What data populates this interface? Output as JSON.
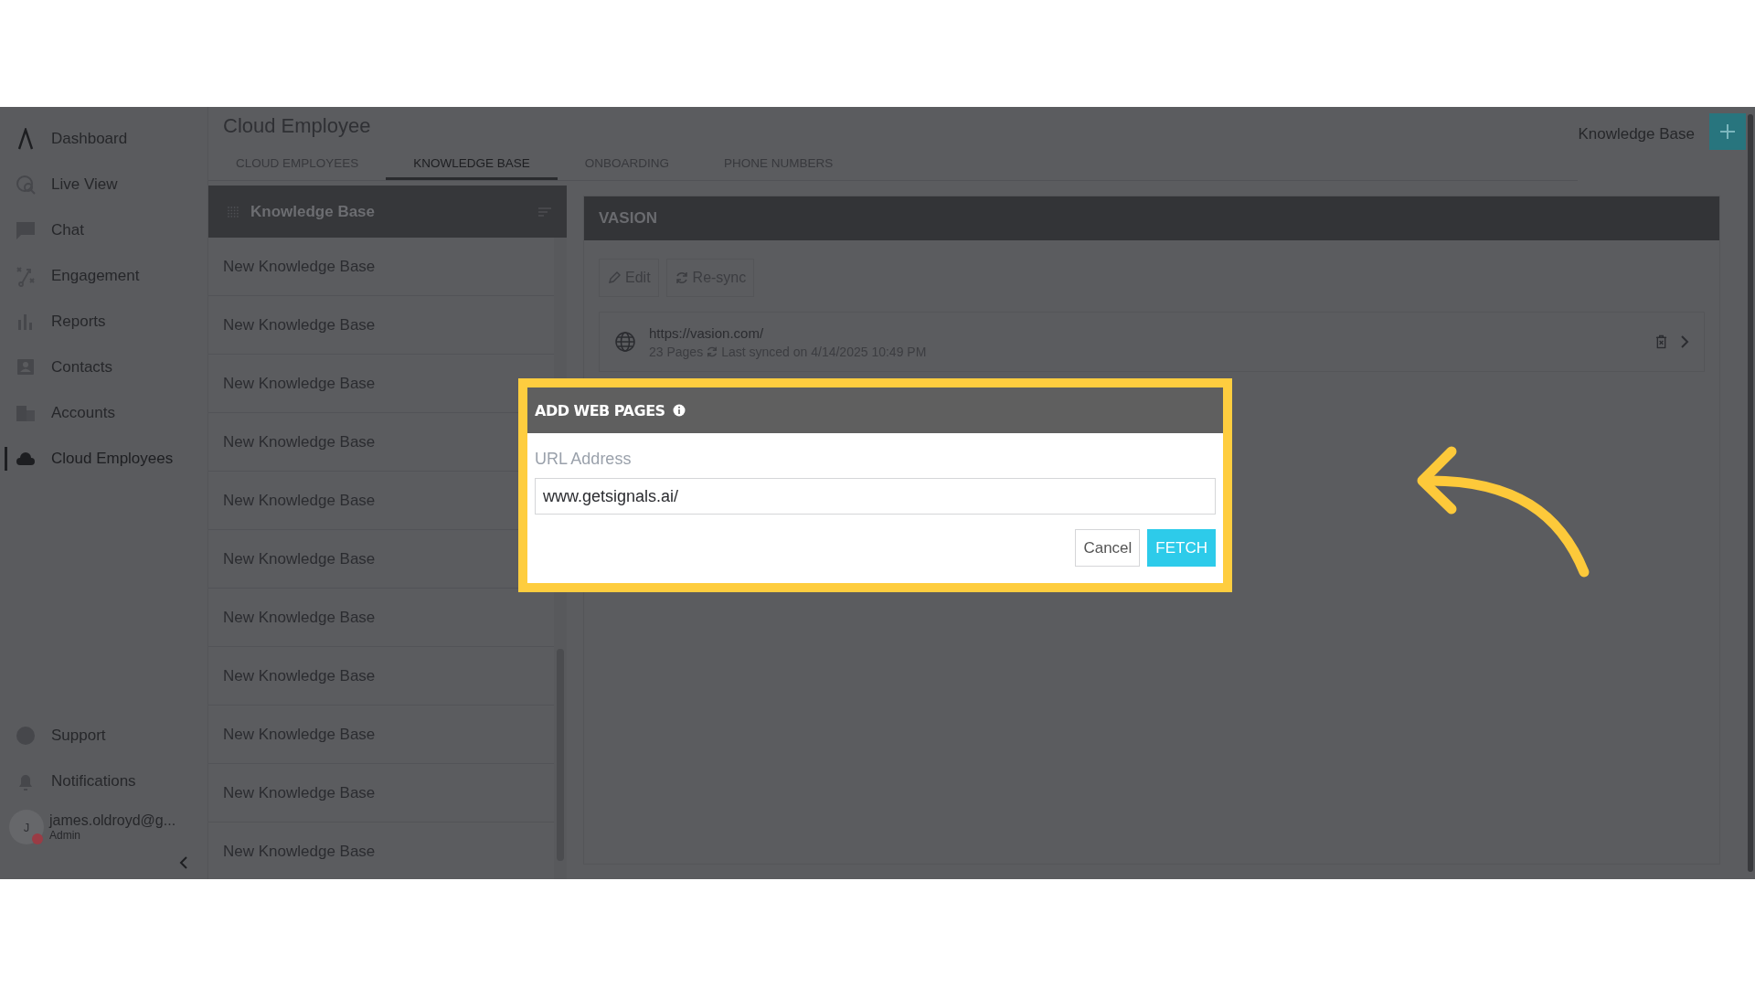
{
  "sidebar": {
    "items": [
      {
        "label": "Dashboard",
        "selected": false
      },
      {
        "label": "Live View",
        "selected": false
      },
      {
        "label": "Chat",
        "selected": false
      },
      {
        "label": "Engagement",
        "selected": false
      },
      {
        "label": "Reports",
        "selected": false
      },
      {
        "label": "Contacts",
        "selected": false
      },
      {
        "label": "Accounts",
        "selected": false
      },
      {
        "label": "Cloud Employees",
        "selected": true
      }
    ],
    "bottom_items": [
      "Support",
      "Notifications"
    ],
    "user": {
      "initial": "J",
      "name": "james.oldroyd@g...",
      "role": "Admin"
    }
  },
  "header": {
    "title": "Cloud Employee",
    "context": "Knowledge Base",
    "tabs": [
      {
        "label": "CLOUD EMPLOYEES",
        "selected": false
      },
      {
        "label": "KNOWLEDGE BASE",
        "selected": true
      },
      {
        "label": "ONBOARDING",
        "selected": false
      },
      {
        "label": "PHONE NUMBERS",
        "selected": false
      }
    ]
  },
  "list": {
    "title": "Knowledge Base",
    "items": [
      "New Knowledge Base",
      "New Knowledge Base",
      "New Knowledge Base",
      "New Knowledge Base",
      "New Knowledge Base",
      "New Knowledge Base",
      "New Knowledge Base",
      "New Knowledge Base",
      "New Knowledge Base",
      "New Knowledge Base",
      "New Knowledge Base"
    ]
  },
  "detail": {
    "title": "VASION",
    "actions": [
      "Edit",
      "Re-sync"
    ],
    "source": {
      "url": "https://vasion.com/",
      "pages": "23 Pages",
      "synced": "Last synced on 4/14/2025 10:49 PM"
    }
  },
  "dialog": {
    "title": "ADD WEB PAGES",
    "field_label": "URL Address",
    "value": "www.getsignals.ai/",
    "buttons": [
      {
        "label": "Cancel",
        "kind": "secondary"
      },
      {
        "label": "FETCH",
        "kind": "primary"
      }
    ]
  }
}
